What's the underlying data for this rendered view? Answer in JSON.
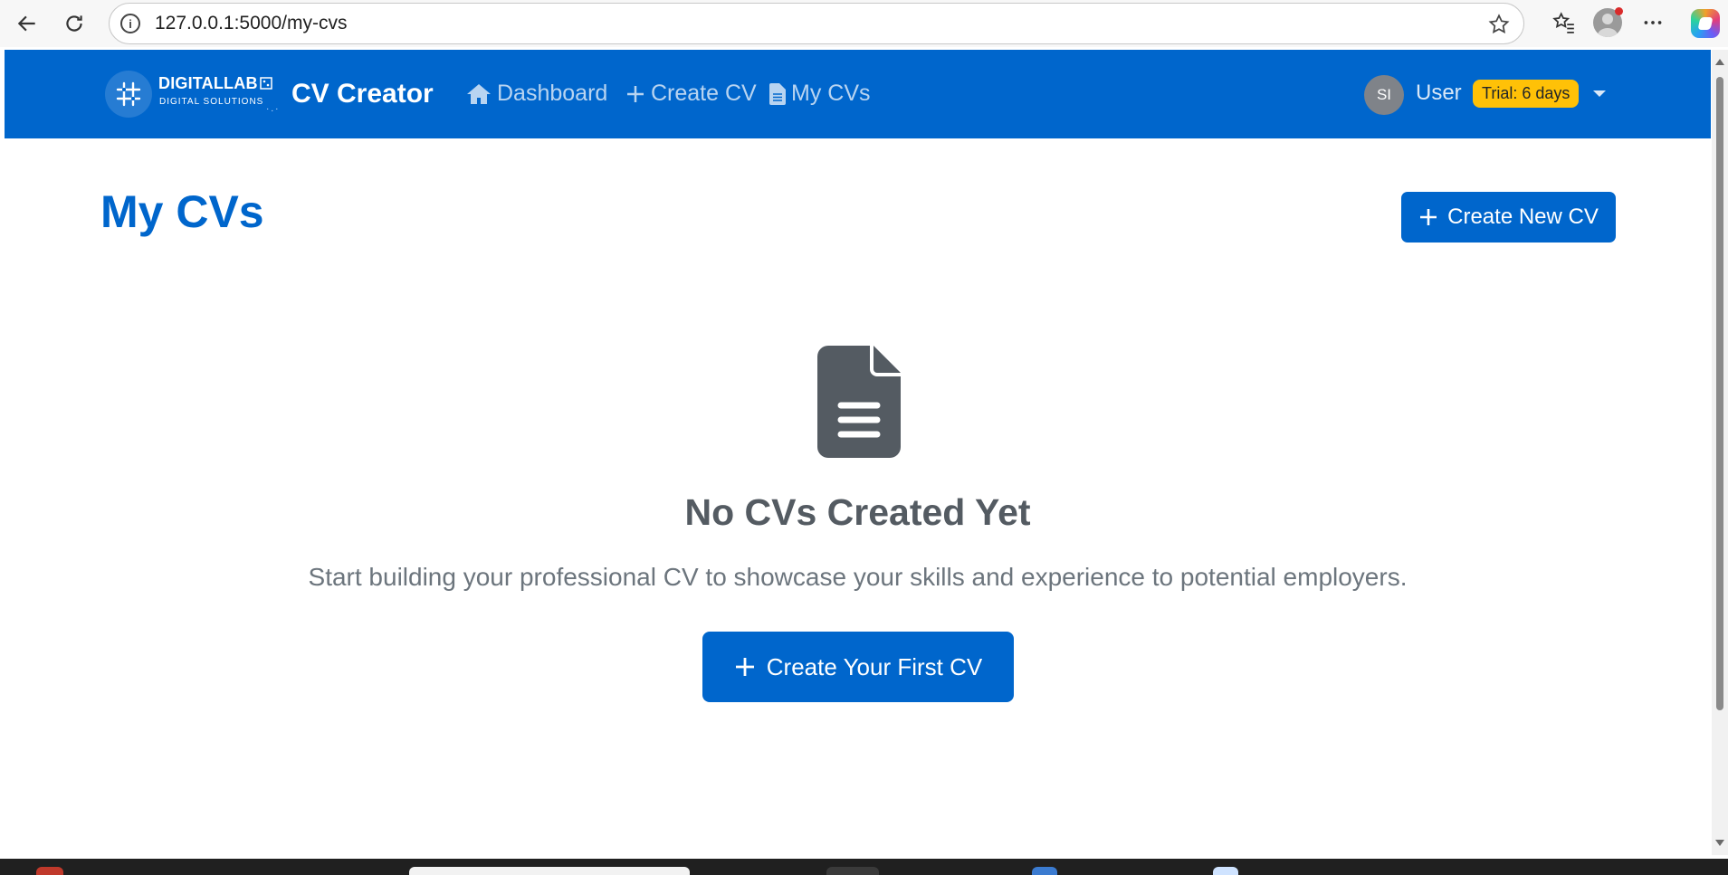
{
  "browser": {
    "url": "127.0.0.1:5000/my-cvs"
  },
  "navbar": {
    "brand_name": "DIGITALLAB",
    "brand_tagline": "DIGITAL SOLUTIONS",
    "app_title": "CV Creator",
    "links": [
      {
        "label": "Dashboard",
        "icon": "home-icon"
      },
      {
        "label": "Create CV",
        "icon": "plus-icon"
      },
      {
        "label": "My CVs",
        "icon": "file-icon"
      }
    ],
    "user": {
      "initials": "SI",
      "name": "User",
      "trial_badge": "Trial: 6 days"
    }
  },
  "main": {
    "page_title": "My CVs",
    "create_new_label": "Create New CV",
    "empty_state": {
      "icon": "document-icon",
      "title": "No CVs Created Yet",
      "message": "Start building your professional CV to showcase your skills and experience to potential employers.",
      "cta_label": "Create Your First CV"
    }
  },
  "colors": {
    "primary": "#0066cc",
    "badge": "#ffc107",
    "empty_icon": "#545b62"
  }
}
